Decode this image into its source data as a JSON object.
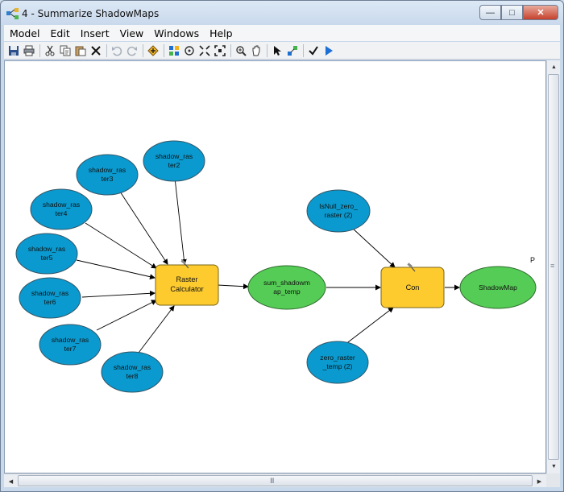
{
  "window": {
    "title": "4 - Summarize ShadowMaps",
    "minimize_glyph": "—",
    "maximize_glyph": "□",
    "close_glyph": "✕"
  },
  "menu": [
    "Model",
    "Edit",
    "Insert",
    "View",
    "Windows",
    "Help"
  ],
  "toolbar_icons": [
    "save-icon",
    "print-icon",
    "cut-icon",
    "copy-icon",
    "paste-icon",
    "delete-icon",
    "undo-icon",
    "redo-icon",
    "add-data-icon",
    "auto-layout-icon",
    "full-extent-icon",
    "fixed-zoom-in-icon",
    "fixed-zoom-out-icon",
    "zoom-in-icon",
    "pan-icon",
    "select-icon",
    "connect-icon",
    "validate-icon",
    "run-icon"
  ],
  "colors": {
    "input_fill": "#0a9acf",
    "tool_fill": "#fecb2f",
    "output_fill": "#55cc55",
    "outline": "#335566"
  },
  "diagram": {
    "inputs": [
      {
        "id": "shadow_raster2",
        "lines": [
          "shadow_ras",
          "ter2"
        ]
      },
      {
        "id": "shadow_raster3",
        "lines": [
          "shadow_ras",
          "ter3"
        ]
      },
      {
        "id": "shadow_raster4",
        "lines": [
          "shadow_ras",
          "ter4"
        ]
      },
      {
        "id": "shadow_raster5",
        "lines": [
          "shadow_ras",
          "ter5"
        ]
      },
      {
        "id": "shadow_raster6",
        "lines": [
          "shadow_ras",
          "ter6"
        ]
      },
      {
        "id": "shadow_raster7",
        "lines": [
          "shadow_ras",
          "ter7"
        ]
      },
      {
        "id": "shadow_raster8",
        "lines": [
          "shadow_ras",
          "ter8"
        ]
      },
      {
        "id": "isnull_zero_raster",
        "lines": [
          "IsNull_zero_",
          "raster (2)"
        ]
      },
      {
        "id": "zero_raster_temp",
        "lines": [
          "zero_raster",
          "_temp (2)"
        ]
      }
    ],
    "tools": [
      {
        "id": "raster_calculator",
        "lines": [
          "Raster",
          "Calculator"
        ]
      },
      {
        "id": "con",
        "lines": [
          "Con"
        ]
      }
    ],
    "outputs": [
      {
        "id": "sum_shadowmap_temp",
        "lines": [
          "sum_shadowm",
          "ap_temp"
        ]
      },
      {
        "id": "shadowmap",
        "lines": [
          "ShadowMap"
        ]
      }
    ],
    "edge_label": "P"
  },
  "scrollbars": {
    "up_glyph": "▲",
    "down_glyph": "▼",
    "left_glyph": "◀",
    "right_glyph": "▶",
    "grip_v": "≡",
    "grip_h": "III"
  }
}
